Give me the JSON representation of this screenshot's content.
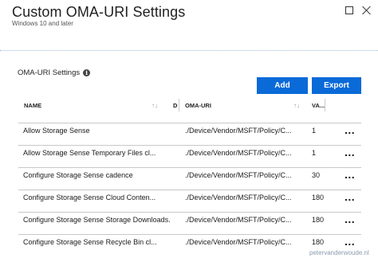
{
  "blade": {
    "title": "Custom OMA-URI Settings",
    "subtitle": "Windows 10 and later"
  },
  "section": {
    "label": "OMA-URI Settings",
    "info_icon": "i"
  },
  "toolbar": {
    "add_label": "Add",
    "export_label": "Export"
  },
  "table": {
    "columns": {
      "name": "NAME",
      "description": "D",
      "oma_uri": "OMA-URI",
      "value": "VA...",
      "sort_icon": "↑↓"
    },
    "rows": [
      {
        "name": "Allow Storage Sense",
        "oma_uri": "./Device/Vendor/MSFT/Policy/C...",
        "value": "1",
        "more": "..."
      },
      {
        "name": "Allow Storage Sense Temporary Files cl...",
        "oma_uri": "./Device/Vendor/MSFT/Policy/C...",
        "value": "1",
        "more": "..."
      },
      {
        "name": "Configure Storage Sense cadence",
        "oma_uri": "./Device/Vendor/MSFT/Policy/C...",
        "value": "30",
        "more": "..."
      },
      {
        "name": "Configure Storage Sense Cloud Conten...",
        "oma_uri": "./Device/Vendor/MSFT/Policy/C...",
        "value": "180",
        "more": "..."
      },
      {
        "name": "Configure Storage Sense Storage Downloads...",
        "oma_uri": "./Device/Vendor/MSFT/Policy/C...",
        "value": "180",
        "more": "..."
      },
      {
        "name": "Configure Storage Sense Recycle Bin cl...",
        "oma_uri": "./Device/Vendor/MSFT/Policy/C...",
        "value": "180",
        "more": "..."
      }
    ]
  },
  "watermark": "petervanderwoude.nl",
  "colors": {
    "accent": "#0a6ad8",
    "divider": "#9fb8d8"
  }
}
